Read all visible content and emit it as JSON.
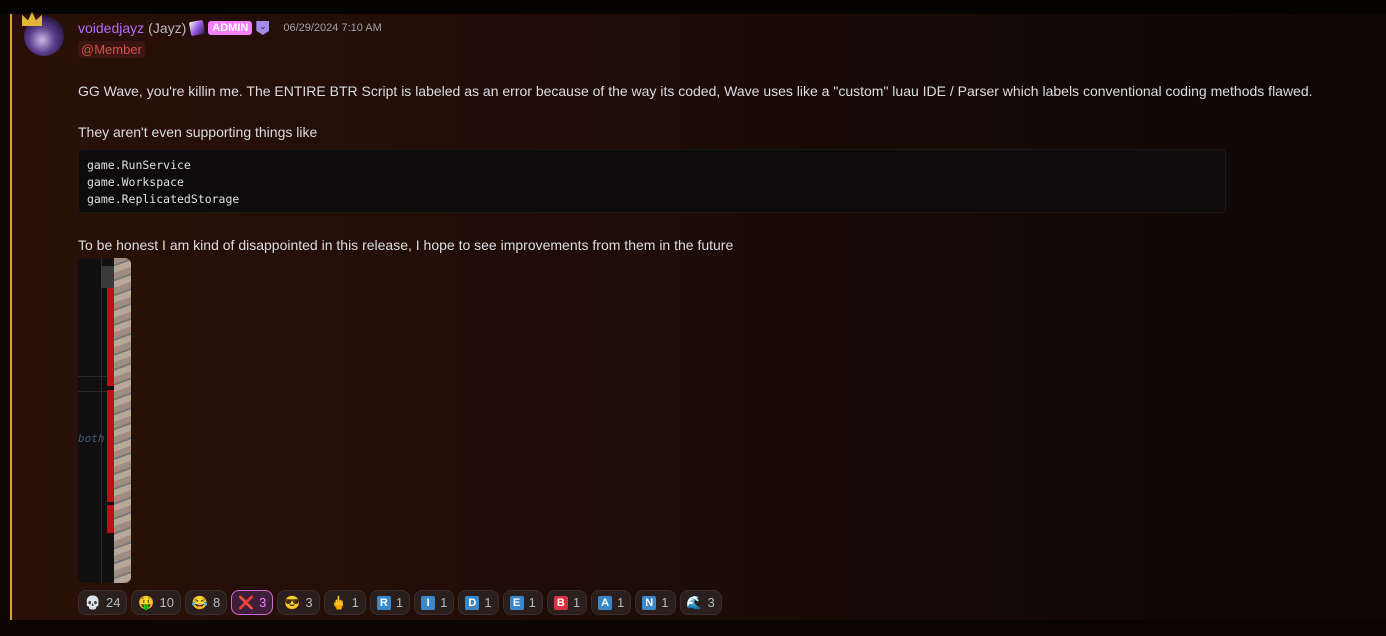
{
  "message": {
    "username": "voidedjayz",
    "nickname": "(Jayz)",
    "badge": "ADMIN",
    "timestamp": "06/29/2024 7:10 AM",
    "role_mention": "@Member",
    "line1": "GG Wave, you're killin me. The ENTIRE BTR Script is labeled as an error because of the way its coded, Wave uses like a \"custom\" luau IDE / Parser which labels conventional coding methods flawed.",
    "line2": "They aren't even supporting things like",
    "code": [
      "game.RunService",
      "game.Workspace",
      "game.ReplicatedStorage"
    ],
    "line3": "To be honest I am kind of disappointed in this release, I hope to see improvements from them in the future",
    "image_text": "both"
  },
  "reactions": [
    {
      "emoji": "💀",
      "count": "24"
    },
    {
      "emoji": "🤑",
      "count": "10"
    },
    {
      "emoji": "😂",
      "count": "8"
    },
    {
      "emoji": "❌",
      "count": "3",
      "active": true
    },
    {
      "emoji": "😎",
      "count": "3"
    },
    {
      "emoji": "🖕",
      "count": "1"
    },
    {
      "emoji": "R",
      "count": "1"
    },
    {
      "emoji": "I",
      "count": "1"
    },
    {
      "emoji": "D",
      "count": "1"
    },
    {
      "emoji": "E",
      "count": "1"
    },
    {
      "emoji": "B",
      "count": "1"
    },
    {
      "emoji": "A",
      "count": "1"
    },
    {
      "emoji": "N",
      "count": "1"
    },
    {
      "emoji": "🌊",
      "count": "3"
    }
  ],
  "colors": {
    "username": "#b36cf0",
    "admin": "#f47fff",
    "mention": "#d8504a",
    "accent_border": "#d9a23a"
  }
}
